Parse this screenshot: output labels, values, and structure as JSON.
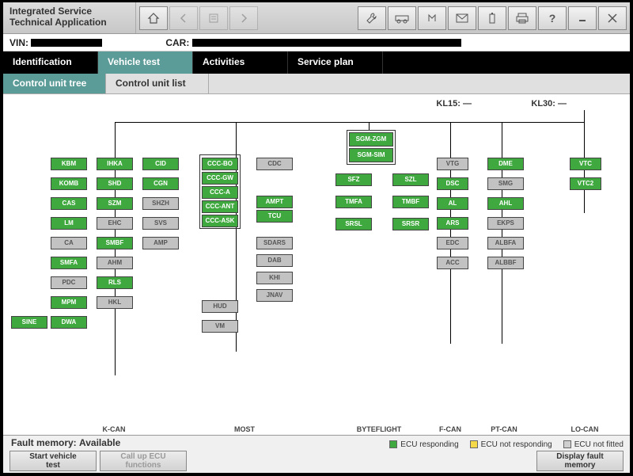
{
  "app": {
    "title_line1": "Integrated Service",
    "title_line2": "Technical Application"
  },
  "info": {
    "vin_label": "VIN:",
    "car_label": "CAR:"
  },
  "main_tabs": [
    "Identification",
    "Vehicle test",
    "Activities",
    "Service plan"
  ],
  "main_active": 1,
  "sub_tabs": [
    "Control unit tree",
    "Control unit list"
  ],
  "sub_active": 0,
  "kl15_label": "KL15:",
  "kl15_val": "—",
  "kl30_label": "KL30:",
  "kl30_val": "—",
  "bus_labels": [
    "K-CAN",
    "MOST",
    "BYTEFLIGHT",
    "F-CAN",
    "PT-CAN",
    "LO-CAN"
  ],
  "sgm_top": "SGM-ZGM",
  "sgm_bot": "SGM-SIM",
  "kcan_cols": [
    [
      "KBM",
      "KOMB",
      "CAS",
      "LM",
      "CA",
      "SMFA",
      "PDC",
      "MPM",
      "SINE"
    ],
    [
      "IHKA",
      "SHD",
      "SZM",
      "EHC",
      "SMBF",
      "AHM",
      "RLS",
      "HKL",
      "DWA"
    ],
    [
      "CID",
      "CGN",
      "SHZH",
      "SVS",
      "AMP"
    ]
  ],
  "kcan_types": [
    [
      "g",
      "g",
      "g",
      "g",
      "y",
      "g",
      "y",
      "g",
      "g"
    ],
    [
      "g",
      "g",
      "g",
      "y",
      "g",
      "y",
      "g",
      "y",
      "g"
    ],
    [
      "g",
      "g",
      "y",
      "y",
      "y"
    ]
  ],
  "most_left": [
    "CCC-BO",
    "CCC-GW",
    "CCC-A",
    "CCC-ANT",
    "CCC-ASK"
  ],
  "most_left_types": [
    "g",
    "g",
    "g",
    "g",
    "g"
  ],
  "most_cdc": "CDC",
  "most_amp": [
    "AMPT",
    "TCU"
  ],
  "most_amp_types": [
    "g",
    "g"
  ],
  "most_right": [
    "SDARS",
    "DAB",
    "KHI",
    "JNAV"
  ],
  "most_bottom_left": [
    "HUD",
    "VM"
  ],
  "byteflight": [
    [
      "SFZ",
      "SZL"
    ],
    [
      "TMFA",
      "TMBF"
    ],
    [
      "SRSL",
      "SRSR"
    ]
  ],
  "byteflight_types": [
    [
      "g",
      "g"
    ],
    [
      "g",
      "g"
    ],
    [
      "g",
      "g"
    ]
  ],
  "fcan": [
    "VTG",
    "DSC",
    "AL",
    "ARS",
    "EDC",
    "ACC"
  ],
  "fcan_types": [
    "y",
    "g",
    "g",
    "g",
    "y",
    "y"
  ],
  "ptcan": [
    "DME",
    "SMG",
    "AHL",
    "EKPS",
    "ALBFA",
    "ALBBF"
  ],
  "ptcan_types": [
    "g",
    "y",
    "g",
    "y",
    "y",
    "y"
  ],
  "locan": [
    "VTC",
    "VTC2"
  ],
  "locan_types": [
    "g",
    "g"
  ],
  "legend": {
    "resp": "ECU responding",
    "notresp": "ECU not responding",
    "notfit": "ECU not fitted"
  },
  "fault": {
    "label": "Fault memory:",
    "value": "Available"
  },
  "buttons": {
    "start": "Start vehicle\ntest",
    "callup": "Call up ECU\nfunctions",
    "display": "Display fault\nmemory"
  }
}
